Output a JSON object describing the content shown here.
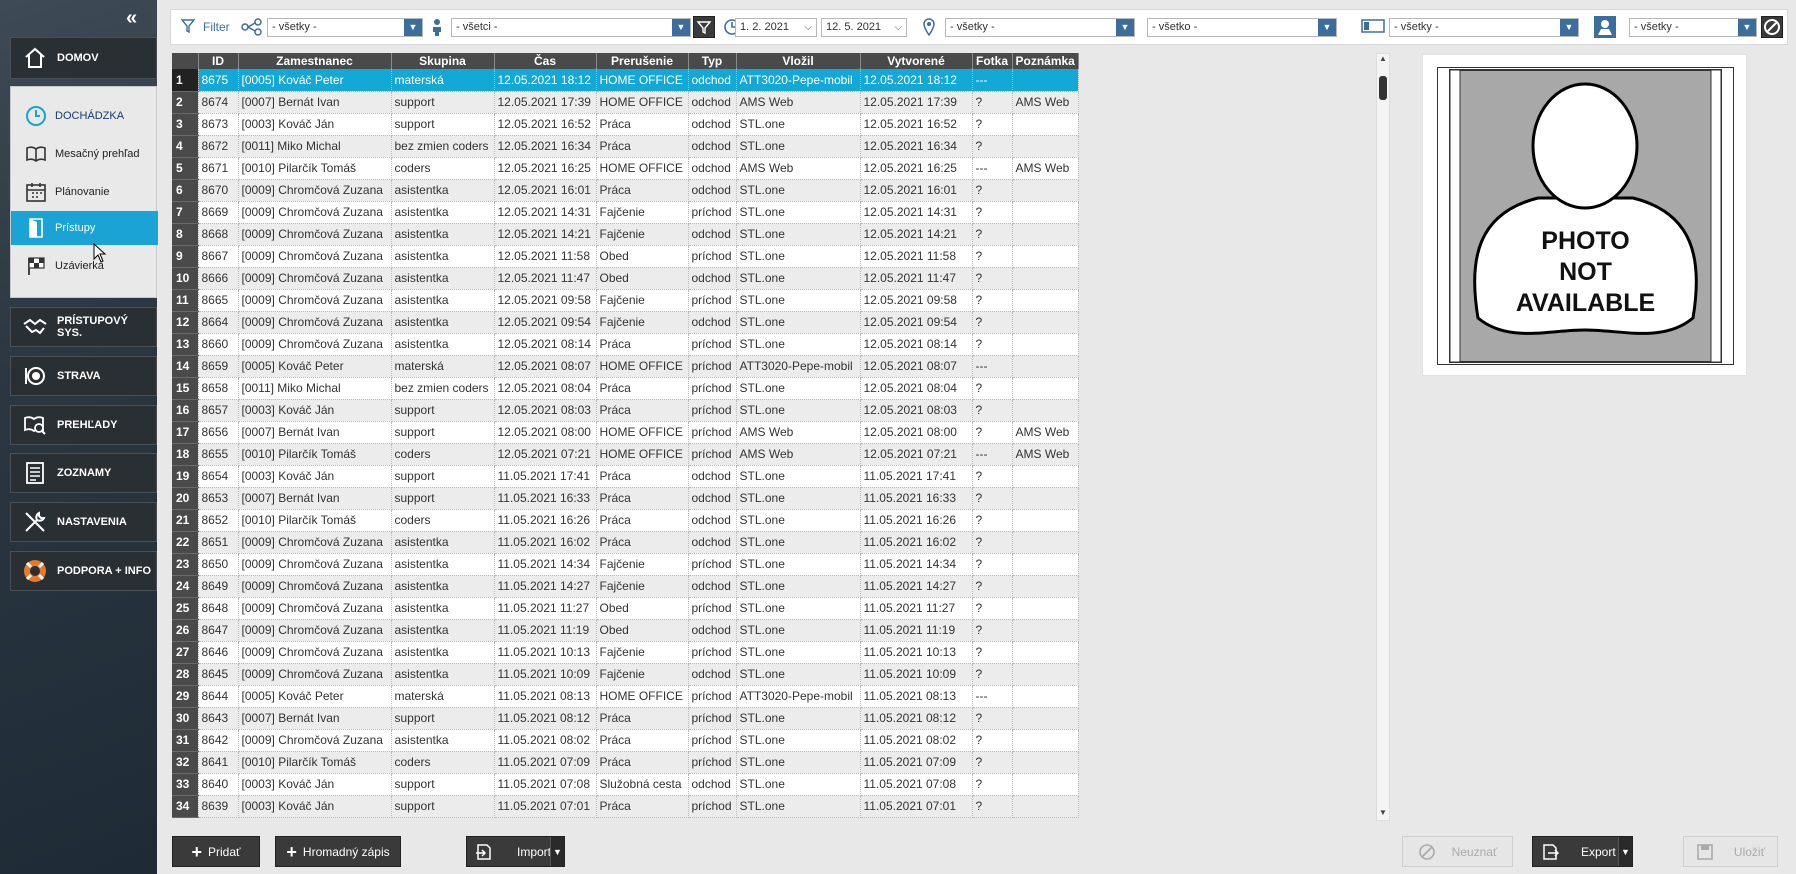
{
  "sidebar": {
    "collapse_glyph": "«",
    "home": "DOMOV",
    "submenu": {
      "head": "DOCHÁDZKA",
      "items": [
        "Mesačný prehľad",
        "Plánovanie",
        "Prístupy",
        "Uzávierka"
      ]
    },
    "main_items": [
      "PRÍSTUPOVÝ SYS.",
      "STRAVA",
      "PREHĽADY",
      "ZOZNAMY",
      "NASTAVENIA",
      "PODPORA + INFO"
    ]
  },
  "filterbar": {
    "filter_label": "Filter",
    "group_value": "- všetky -",
    "employee_value": "- všetci -",
    "date_from": "1. 2. 2021",
    "date_to": "12. 5. 2021",
    "location_value": "- všetky -",
    "type_value": "- všetko -",
    "terminal_value": "- všetky -",
    "source_value": "- všetky -"
  },
  "table": {
    "columns": [
      "ID",
      "Zamestnanec",
      "Skupina",
      "Čas",
      "Prerušenie",
      "Typ",
      "Vložil",
      "Vytvorené",
      "Fotka",
      "Poznámka"
    ],
    "rows": [
      [
        "1",
        "8675",
        "[0005] Kováč Peter",
        "materská",
        "12.05.2021 18:12",
        "HOME OFFICE",
        "odchod",
        "ATT3020-Pepe-mobil",
        "12.05.2021 18:12",
        "---",
        ""
      ],
      [
        "2",
        "8674",
        "[0007] Bernát Ivan",
        "support",
        "12.05.2021 17:39",
        "HOME OFFICE",
        "odchod",
        "AMS Web",
        "12.05.2021 17:39",
        "?",
        "AMS Web"
      ],
      [
        "3",
        "8673",
        "[0003] Kováč Ján",
        "support",
        "12.05.2021 16:52",
        "Práca",
        "odchod",
        "STL.one",
        "12.05.2021 16:52",
        "?",
        ""
      ],
      [
        "4",
        "8672",
        "[0011] Miko Michal",
        "bez zmien coders",
        "12.05.2021 16:34",
        "Práca",
        "odchod",
        "STL.one",
        "12.05.2021 16:34",
        "?",
        ""
      ],
      [
        "5",
        "8671",
        "[0010] Pilarčík Tomáš",
        "coders",
        "12.05.2021 16:25",
        "HOME OFFICE",
        "odchod",
        "AMS Web",
        "12.05.2021 16:25",
        "---",
        "AMS Web"
      ],
      [
        "6",
        "8670",
        "[0009] Chromčová Zuzana",
        "asistentka",
        "12.05.2021 16:01",
        "Práca",
        "odchod",
        "STL.one",
        "12.05.2021 16:01",
        "?",
        ""
      ],
      [
        "7",
        "8669",
        "[0009] Chromčová Zuzana",
        "asistentka",
        "12.05.2021 14:31",
        "Fajčenie",
        "príchod",
        "STL.one",
        "12.05.2021 14:31",
        "?",
        ""
      ],
      [
        "8",
        "8668",
        "[0009] Chromčová Zuzana",
        "asistentka",
        "12.05.2021 14:21",
        "Fajčenie",
        "odchod",
        "STL.one",
        "12.05.2021 14:21",
        "?",
        ""
      ],
      [
        "9",
        "8667",
        "[0009] Chromčová Zuzana",
        "asistentka",
        "12.05.2021 11:58",
        "Obed",
        "príchod",
        "STL.one",
        "12.05.2021 11:58",
        "?",
        ""
      ],
      [
        "10",
        "8666",
        "[0009] Chromčová Zuzana",
        "asistentka",
        "12.05.2021 11:47",
        "Obed",
        "odchod",
        "STL.one",
        "12.05.2021 11:47",
        "?",
        ""
      ],
      [
        "11",
        "8665",
        "[0009] Chromčová Zuzana",
        "asistentka",
        "12.05.2021 09:58",
        "Fajčenie",
        "príchod",
        "STL.one",
        "12.05.2021 09:58",
        "?",
        ""
      ],
      [
        "12",
        "8664",
        "[0009] Chromčová Zuzana",
        "asistentka",
        "12.05.2021 09:54",
        "Fajčenie",
        "odchod",
        "STL.one",
        "12.05.2021 09:54",
        "?",
        ""
      ],
      [
        "13",
        "8660",
        "[0009] Chromčová Zuzana",
        "asistentka",
        "12.05.2021 08:14",
        "Práca",
        "príchod",
        "STL.one",
        "12.05.2021 08:14",
        "?",
        ""
      ],
      [
        "14",
        "8659",
        "[0005] Kováč Peter",
        "materská",
        "12.05.2021 08:07",
        "HOME OFFICE",
        "príchod",
        "ATT3020-Pepe-mobil",
        "12.05.2021 08:07",
        "---",
        ""
      ],
      [
        "15",
        "8658",
        "[0011] Miko Michal",
        "bez zmien coders",
        "12.05.2021 08:04",
        "Práca",
        "príchod",
        "STL.one",
        "12.05.2021 08:04",
        "?",
        ""
      ],
      [
        "16",
        "8657",
        "[0003] Kováč Ján",
        "support",
        "12.05.2021 08:03",
        "Práca",
        "príchod",
        "STL.one",
        "12.05.2021 08:03",
        "?",
        ""
      ],
      [
        "17",
        "8656",
        "[0007] Bernát Ivan",
        "support",
        "12.05.2021 08:00",
        "HOME OFFICE",
        "príchod",
        "AMS Web",
        "12.05.2021 08:00",
        "?",
        "AMS Web"
      ],
      [
        "18",
        "8655",
        "[0010] Pilarčík Tomáš",
        "coders",
        "12.05.2021 07:21",
        "HOME OFFICE",
        "príchod",
        "AMS Web",
        "12.05.2021 07:21",
        "---",
        "AMS Web"
      ],
      [
        "19",
        "8654",
        "[0003] Kováč Ján",
        "support",
        "11.05.2021 17:41",
        "Práca",
        "odchod",
        "STL.one",
        "11.05.2021 17:41",
        "?",
        ""
      ],
      [
        "20",
        "8653",
        "[0007] Bernát Ivan",
        "support",
        "11.05.2021 16:33",
        "Práca",
        "odchod",
        "STL.one",
        "11.05.2021 16:33",
        "?",
        ""
      ],
      [
        "21",
        "8652",
        "[0010] Pilarčík Tomáš",
        "coders",
        "11.05.2021 16:26",
        "Práca",
        "odchod",
        "STL.one",
        "11.05.2021 16:26",
        "?",
        ""
      ],
      [
        "22",
        "8651",
        "[0009] Chromčová Zuzana",
        "asistentka",
        "11.05.2021 16:02",
        "Práca",
        "odchod",
        "STL.one",
        "11.05.2021 16:02",
        "?",
        ""
      ],
      [
        "23",
        "8650",
        "[0009] Chromčová Zuzana",
        "asistentka",
        "11.05.2021 14:34",
        "Fajčenie",
        "príchod",
        "STL.one",
        "11.05.2021 14:34",
        "?",
        ""
      ],
      [
        "24",
        "8649",
        "[0009] Chromčová Zuzana",
        "asistentka",
        "11.05.2021 14:27",
        "Fajčenie",
        "odchod",
        "STL.one",
        "11.05.2021 14:27",
        "?",
        ""
      ],
      [
        "25",
        "8648",
        "[0009] Chromčová Zuzana",
        "asistentka",
        "11.05.2021 11:27",
        "Obed",
        "príchod",
        "STL.one",
        "11.05.2021 11:27",
        "?",
        ""
      ],
      [
        "26",
        "8647",
        "[0009] Chromčová Zuzana",
        "asistentka",
        "11.05.2021 11:19",
        "Obed",
        "odchod",
        "STL.one",
        "11.05.2021 11:19",
        "?",
        ""
      ],
      [
        "27",
        "8646",
        "[0009] Chromčová Zuzana",
        "asistentka",
        "11.05.2021 10:13",
        "Fajčenie",
        "príchod",
        "STL.one",
        "11.05.2021 10:13",
        "?",
        ""
      ],
      [
        "28",
        "8645",
        "[0009] Chromčová Zuzana",
        "asistentka",
        "11.05.2021 10:09",
        "Fajčenie",
        "odchod",
        "STL.one",
        "11.05.2021 10:09",
        "?",
        ""
      ],
      [
        "29",
        "8644",
        "[0005] Kováč Peter",
        "materská",
        "11.05.2021 08:13",
        "HOME OFFICE",
        "príchod",
        "ATT3020-Pepe-mobil",
        "11.05.2021 08:13",
        "---",
        ""
      ],
      [
        "30",
        "8643",
        "[0007] Bernát Ivan",
        "support",
        "11.05.2021 08:12",
        "Práca",
        "príchod",
        "STL.one",
        "11.05.2021 08:12",
        "?",
        ""
      ],
      [
        "31",
        "8642",
        "[0009] Chromčová Zuzana",
        "asistentka",
        "11.05.2021 08:02",
        "Práca",
        "príchod",
        "STL.one",
        "11.05.2021 08:02",
        "?",
        ""
      ],
      [
        "32",
        "8641",
        "[0010] Pilarčík Tomáš",
        "coders",
        "11.05.2021 07:09",
        "Práca",
        "príchod",
        "STL.one",
        "11.05.2021 07:09",
        "?",
        ""
      ],
      [
        "33",
        "8640",
        "[0003] Kováč Ján",
        "support",
        "11.05.2021 07:08",
        "Služobná cesta",
        "odchod",
        "STL.one",
        "11.05.2021 07:08",
        "?",
        ""
      ],
      [
        "34",
        "8639",
        "[0003] Kováč Ján",
        "support",
        "11.05.2021 07:01",
        "Práca",
        "príchod",
        "STL.one",
        "11.05.2021 07:01",
        "?",
        ""
      ]
    ]
  },
  "photo": {
    "placeholder_lines": [
      "PHOTO",
      "NOT",
      "AVAILABLE"
    ]
  },
  "buttons": {
    "add": "Pridať",
    "bulk": "Hromadný zápis",
    "import": "Import",
    "reject": "Neuznať",
    "export": "Export",
    "save": "Uložiť"
  },
  "colors": {
    "accent": "#13a8d6",
    "header_dark": "#4a4a4a",
    "filter_icon": "#3b6e9c"
  }
}
